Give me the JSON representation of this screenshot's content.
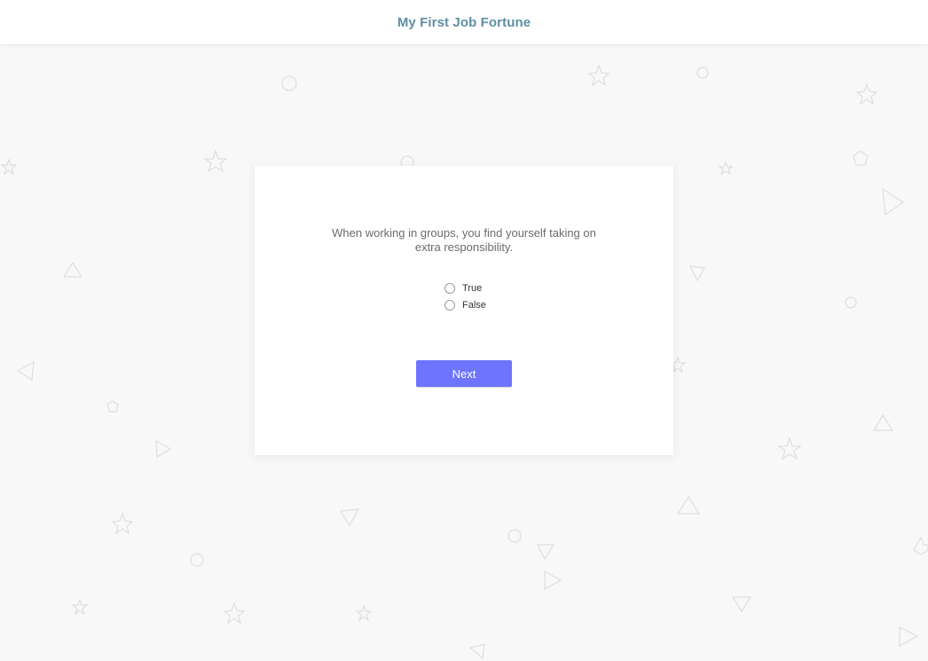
{
  "header": {
    "title": "My First Job Fortune"
  },
  "question": {
    "text": "When working in groups, you find yourself taking on extra responsibility."
  },
  "options": [
    {
      "label": "True"
    },
    {
      "label": "False"
    }
  ],
  "actions": {
    "next_label": "Next"
  },
  "colors": {
    "header_title": "#5e8fa3",
    "button_bg": "#6f74ff",
    "page_bg": "#f8f8f8"
  }
}
